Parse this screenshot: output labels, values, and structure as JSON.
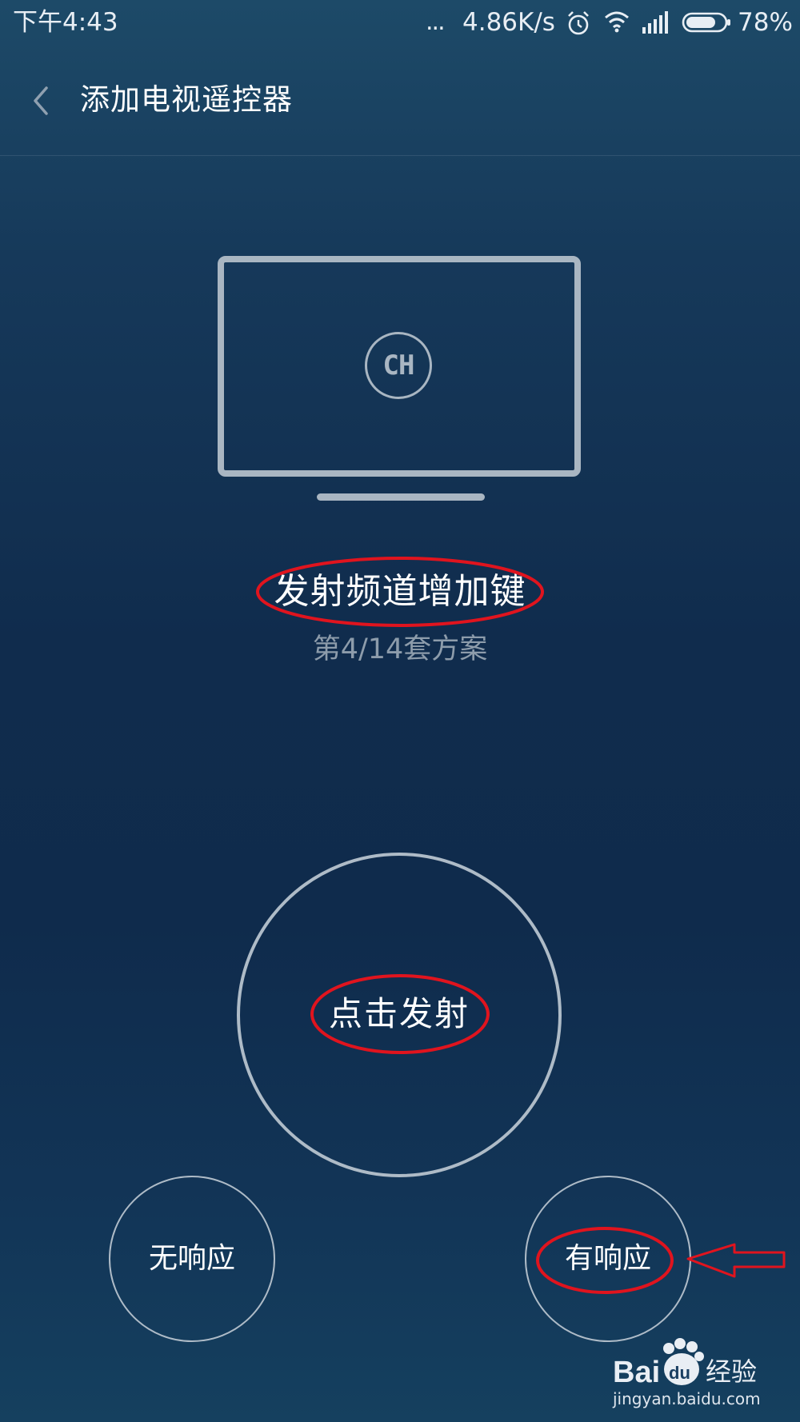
{
  "status_bar": {
    "time": "下午4:43",
    "more": "...",
    "net_speed": "4.86K/s",
    "battery_pct": "78%",
    "battery_level": 0.78,
    "icons": [
      "alarm-icon",
      "wifi-icon",
      "signal-icon",
      "battery-icon"
    ]
  },
  "header": {
    "title": "添加电视遥控器",
    "back_icon": "chevron-left-icon"
  },
  "tv_illustration": {
    "badge": "CH"
  },
  "test_key": {
    "name": "发射频道增加键",
    "scheme": "第4/14套方案"
  },
  "actions": {
    "fire": "点击发射",
    "no_response": "无响应",
    "has_response": "有响应"
  },
  "watermark": {
    "brand": "Bai",
    "brand_du": "du",
    "product": "经验",
    "url": "jingyan.baidu.com"
  },
  "colors": {
    "annotation": "#e0141e",
    "line": "#aebbc7",
    "secondary_text": "#8d9cab"
  }
}
